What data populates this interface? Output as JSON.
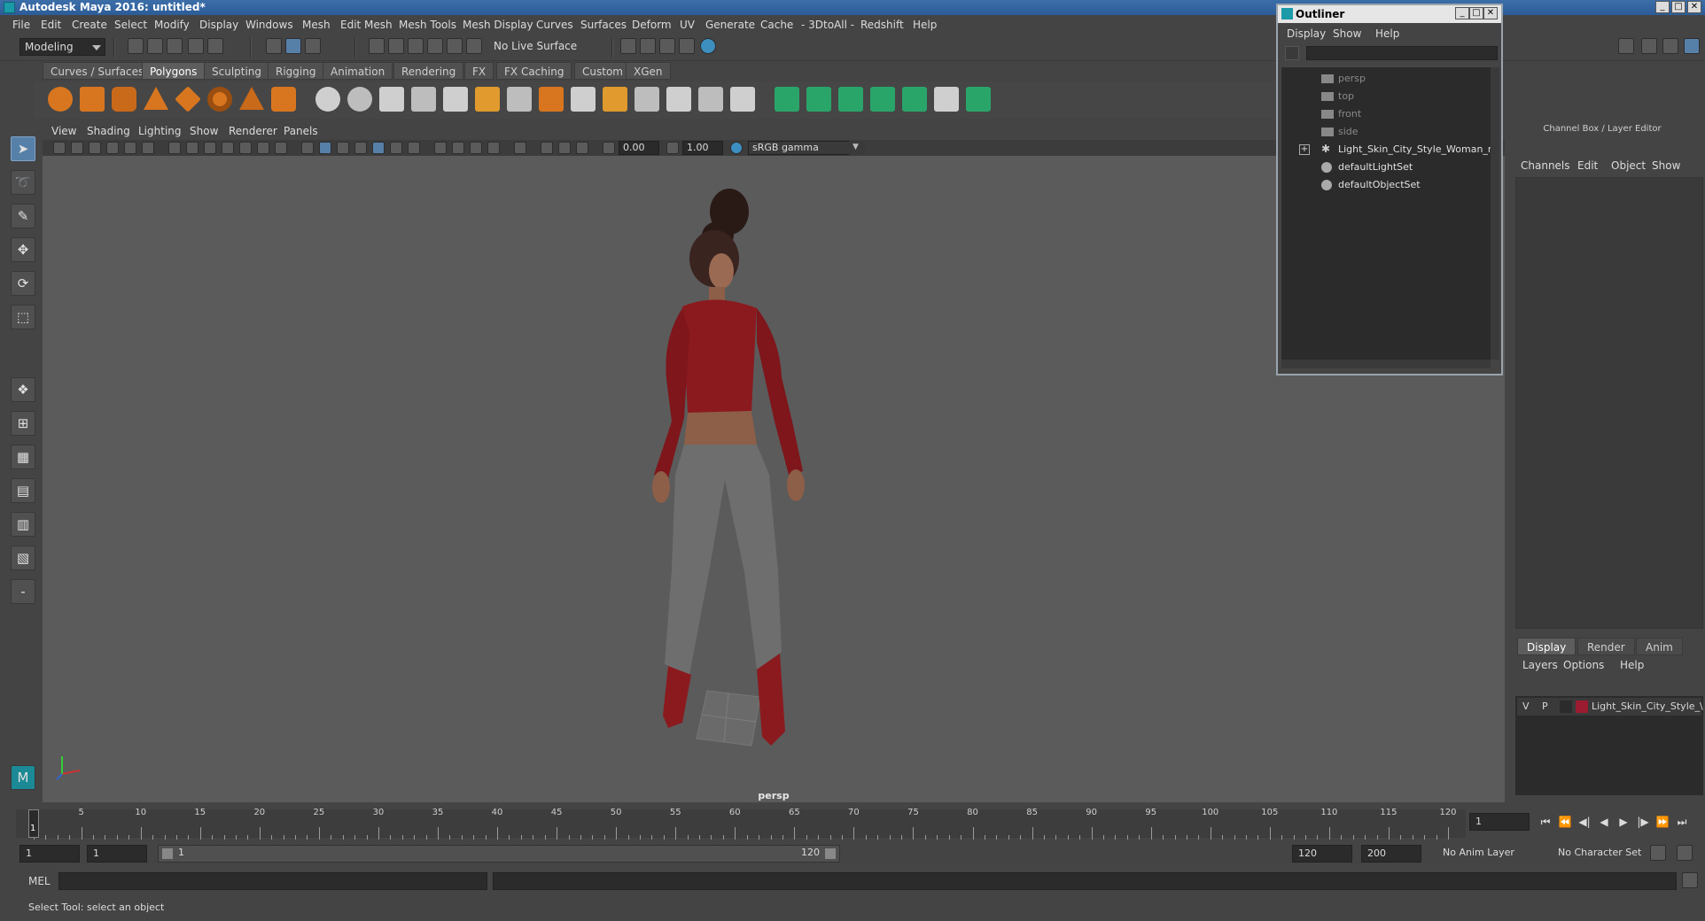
{
  "window": {
    "title": "Autodesk Maya 2016: untitled*",
    "controls": [
      "_",
      "□",
      "✕"
    ]
  },
  "menubar": [
    "File",
    "Edit",
    "Create",
    "Select",
    "Modify",
    "Display",
    "Windows",
    "Mesh",
    "Edit Mesh",
    "Mesh Tools",
    "Mesh Display",
    "Curves",
    "Surfaces",
    "Deform",
    "UV",
    "Generate",
    "Cache",
    "- 3DtoAll -",
    "Redshift",
    "Help"
  ],
  "statusline": {
    "mode": "Modeling",
    "live_surface": "No Live Surface"
  },
  "shelf": {
    "tabs": [
      "Curves / Surfaces",
      "Polygons",
      "Sculpting",
      "Rigging",
      "Animation",
      "Rendering",
      "FX",
      "FX Caching",
      "Custom",
      "XGen"
    ],
    "active_tab": "Polygons"
  },
  "panel": {
    "menu": [
      "View",
      "Shading",
      "Lighting",
      "Show",
      "Renderer",
      "Panels"
    ],
    "exposure": "0.00",
    "gamma": "1.00",
    "colorspace": "sRGB gamma",
    "camera": "persp"
  },
  "outliner": {
    "title": "Outliner",
    "menu": [
      "Display",
      "Show",
      "Help"
    ],
    "items": [
      {
        "label": "persp",
        "icon": "camera-icon",
        "dim": true
      },
      {
        "label": "top",
        "icon": "camera-icon",
        "dim": true
      },
      {
        "label": "front",
        "icon": "camera-icon",
        "dim": true
      },
      {
        "label": "side",
        "icon": "camera-icon",
        "dim": true
      },
      {
        "label": "Light_Skin_City_Style_Woman_ncl",
        "icon": "transform-icon",
        "dim": false,
        "expandable": true
      },
      {
        "label": "defaultLightSet",
        "icon": "set-icon",
        "dim": false
      },
      {
        "label": "defaultObjectSet",
        "icon": "set-icon",
        "dim": false
      }
    ]
  },
  "channelbox": {
    "title": "Channel Box / Layer Editor",
    "menu": [
      "Channels",
      "Edit",
      "Object",
      "Show"
    ],
    "layer_tabs": [
      "Display",
      "Render",
      "Anim"
    ],
    "active_layer_tab": "Display",
    "layer_menu": [
      "Layers",
      "Options",
      "Help"
    ],
    "layer": {
      "v": "V",
      "p": "P",
      "name": "Light_Skin_City_Style_\\",
      "color": "#9b1b30"
    }
  },
  "timeslider": {
    "ticks": [
      5,
      10,
      15,
      20,
      25,
      30,
      35,
      40,
      45,
      50,
      55,
      60,
      65,
      70,
      75,
      80,
      85,
      90,
      95,
      100,
      105,
      110,
      115,
      120
    ],
    "start": 1,
    "end": 120,
    "current_frame": "1",
    "current_field": "1"
  },
  "range": {
    "start_a": "1",
    "start_b": "1",
    "range_start": "1",
    "range_end": "120",
    "end_a": "120",
    "end_b": "200",
    "anim_layer": "No Anim Layer",
    "character_set": "No Character Set"
  },
  "cmdline": {
    "language": "MEL"
  },
  "helpline": {
    "text": "Select Tool: select an object"
  },
  "colors": {
    "accent": "#5680a8",
    "shirt": "#8b1a1f",
    "pants": "#6e6e6e"
  }
}
